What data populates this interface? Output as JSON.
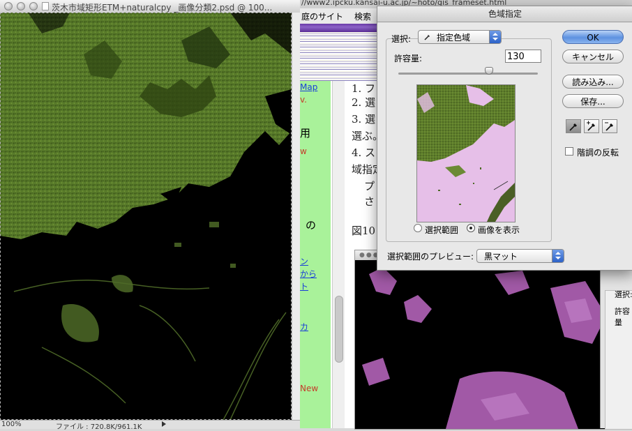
{
  "ps_window": {
    "title": "茨木市域矩形ETM+naturalcpy _画像分類2.psd @ 100...",
    "status_zoom": "100%",
    "status_file": "ファイル : 720.8K/961.1K"
  },
  "browser": {
    "url": "//www2.ipcku.kansai-u.ac.jp/~hoto/gis_frameset.html",
    "bookmark_site": "庭のサイト",
    "bookmark_search": "検索",
    "sidebar": {
      "link_map": "Map",
      "small_text": "v.",
      "heading_use": "用",
      "red_w": "w",
      "heading_no": "の",
      "link_a": "ン",
      "link_b": "から",
      "link_c": "ト",
      "link_d": "カ",
      "red_new": "New"
    },
    "content_lines": [
      "1. フ",
      "2. 選",
      "3. 選",
      "選ぶ。",
      "4. ス",
      "域指定",
      "プ",
      "さ"
    ],
    "figure_caption": "図10"
  },
  "side_dialog": {
    "label_select": "選択:",
    "label_tolerance": "許容量"
  },
  "color_range_dialog": {
    "title": "色域指定",
    "select_label": "選択:",
    "select_value": "指定色域",
    "tolerance_label": "許容量:",
    "tolerance_value": "130",
    "tolerance_slider": 130,
    "tolerance_max": 200,
    "radio_selection": "選択範囲",
    "radio_image": "画像を表示",
    "radio_selected": "image",
    "matte_label": "選択範囲のプレビュー:",
    "matte_value": "黒マット",
    "buttons": {
      "ok": "OK",
      "cancel": "キャンセル",
      "load": "読み込み...",
      "save": "保存..."
    },
    "invert_label": "階調の反転",
    "invert_checked": false,
    "eyedropper_icons": [
      "eyedropper-icon",
      "eyedropper-plus-icon",
      "eyedropper-minus-icon"
    ]
  },
  "colors": {
    "accent_blue": "#5d91e0",
    "browser_purple": "#6a3aa8",
    "sidebar_green": "#a9f29a",
    "selection_pink": "#e6bfe8",
    "terrain_green": "#5c7a2c"
  }
}
